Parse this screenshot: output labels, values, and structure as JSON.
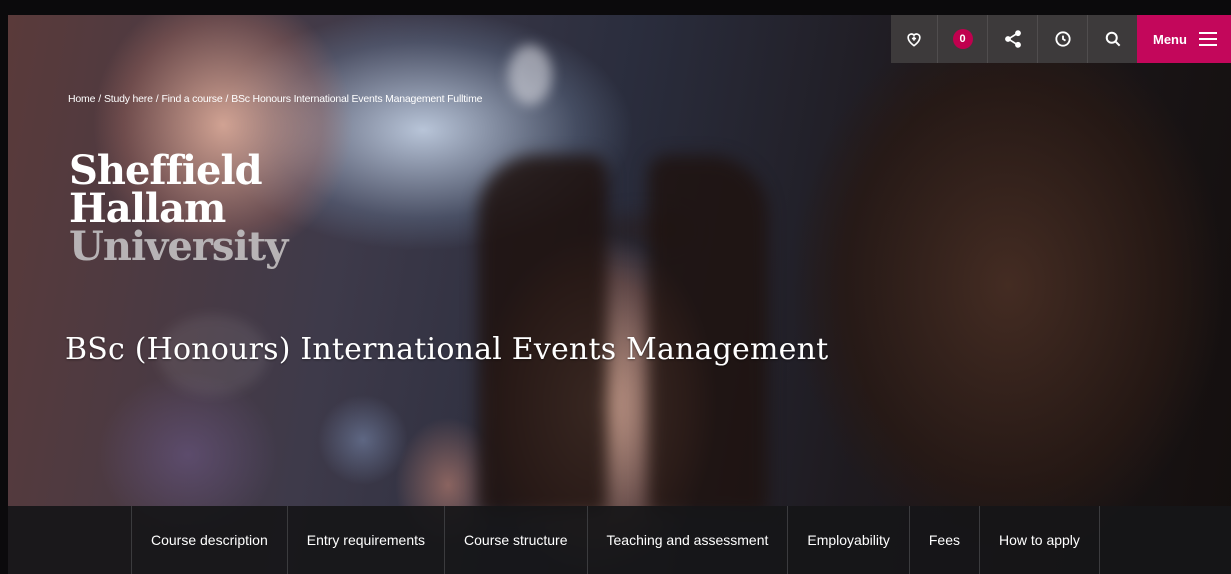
{
  "toolbar": {
    "shortlist_count": "0",
    "menu_label": "Menu"
  },
  "breadcrumb": [
    "Home",
    "Study here",
    "Find a course",
    "BSc Honours International Events Management Fulltime"
  ],
  "logo": {
    "line1": "Sheffield",
    "line2": "Hallam",
    "line3": "University"
  },
  "course_title": "BSc (Honours) International Events Management",
  "subnav": {
    "items": [
      "Course description",
      "Entry requirements",
      "Course structure",
      "Teaching and assessment",
      "Employability",
      "Fees",
      "How to apply"
    ]
  },
  "colors": {
    "accent": "#c3075b",
    "toolbar_bg": "#3d3a3b",
    "subnav_bg": "#161618"
  }
}
